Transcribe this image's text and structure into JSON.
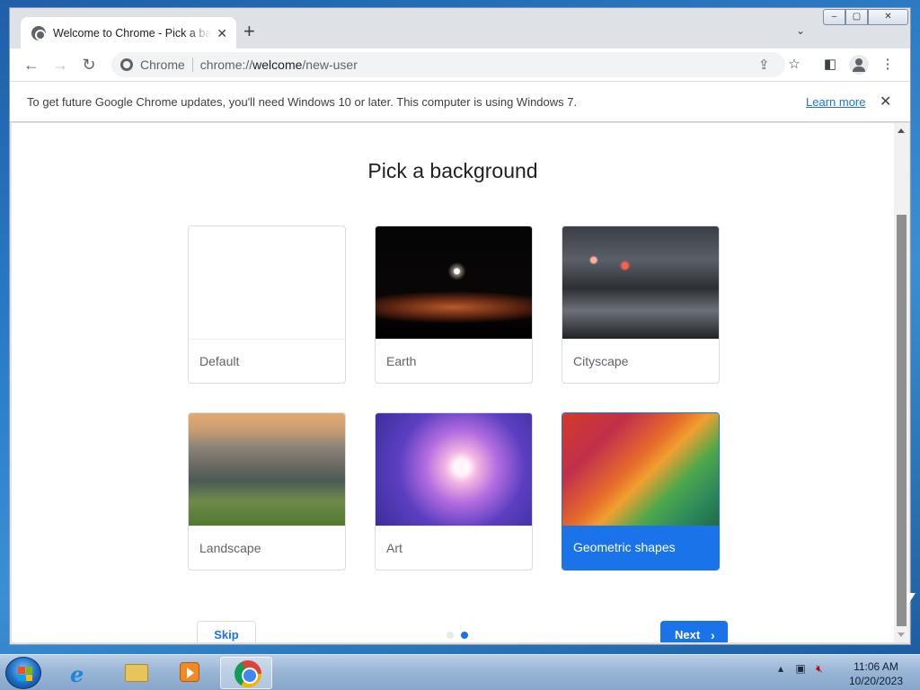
{
  "browser": {
    "tab_title": "Welcome to Chrome - Pick a background",
    "new_tab_symbol": "+",
    "omnibox": {
      "chip": "Chrome",
      "url_prefix": "chrome://",
      "url_host": "welcome",
      "url_path": "/new-user"
    }
  },
  "infobar": {
    "message": "To get future Google Chrome updates, you'll need Windows 10 or later. This computer is using Windows 7.",
    "learn_more": "Learn more"
  },
  "page": {
    "heading": "Pick a background",
    "backgrounds": [
      {
        "label": "Default",
        "selected": false
      },
      {
        "label": "Earth",
        "selected": false
      },
      {
        "label": "Cityscape",
        "selected": false
      },
      {
        "label": "Landscape",
        "selected": false
      },
      {
        "label": "Art",
        "selected": false
      },
      {
        "label": "Geometric shapes",
        "selected": true
      }
    ],
    "skip_label": "Skip",
    "next_label": "Next",
    "pager": {
      "count": 2,
      "active_index": 1
    }
  },
  "taskbar": {
    "clock_time": "11:06 AM",
    "clock_date": "10/20/2023",
    "pinned": [
      "internet-explorer",
      "file-explorer",
      "media-player",
      "chrome"
    ]
  },
  "colors": {
    "accent": "#1a73e8"
  }
}
